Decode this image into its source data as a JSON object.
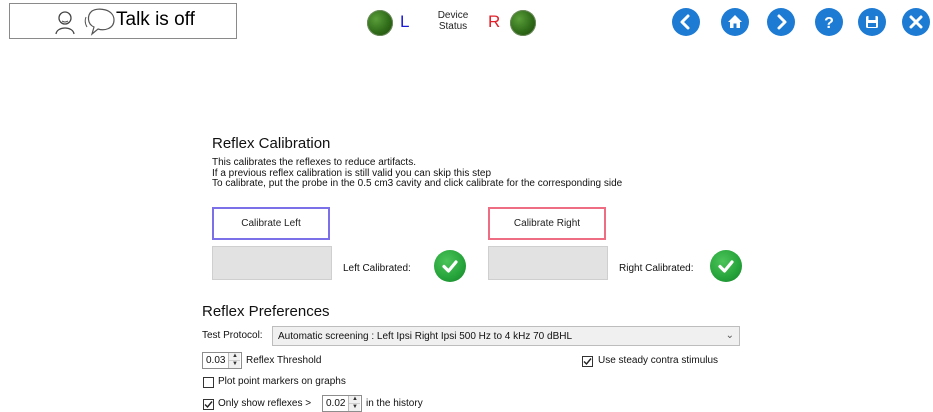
{
  "topbar": {
    "talk_status": "Talk is off",
    "side_left": "L",
    "side_right": "R",
    "device_status_line1": "Device",
    "device_status_line2": "Status",
    "icons": [
      "person-speaking-icon",
      "speech-bubble-icon",
      "back-icon",
      "home-icon",
      "forward-icon",
      "help-icon",
      "save-icon",
      "close-icon"
    ],
    "colors": {
      "nav_blue": "#1d7bd4",
      "led_green": "#2f6b18",
      "left_blue": "#1b1bd6",
      "right_red": "#e0202a"
    }
  },
  "calibration": {
    "title": "Reflex Calibration",
    "desc1": "This calibrates the reflexes to reduce artifacts.",
    "desc2": "If a previous reflex calibration is still valid you can skip this step",
    "desc3": "To calibrate, put the probe in the 0.5 cm3 cavity and click calibrate for the corresponding side",
    "left_button": "Calibrate Left",
    "right_button": "Calibrate Right",
    "left_status": "Left Calibrated:",
    "right_status": "Right Calibrated:",
    "left_calibrated": true,
    "right_calibrated": true
  },
  "preferences": {
    "title": "Reflex Preferences",
    "test_protocol_label": "Test Protocol:",
    "test_protocol_value": "Automatic screening : Left Ipsi Right Ipsi 500 Hz to 4 kHz 70 dBHL",
    "reflex_threshold_value": "0.03",
    "reflex_threshold_label": "Reflex Threshold",
    "steady_contra_label": "Use steady contra stimulus",
    "steady_contra_checked": true,
    "plot_markers_label": "Plot point markers on graphs",
    "plot_markers_checked": false,
    "only_show_label": "Only show reflexes >",
    "only_show_checked": true,
    "only_show_value": "0.02",
    "history_label": "in the history"
  }
}
